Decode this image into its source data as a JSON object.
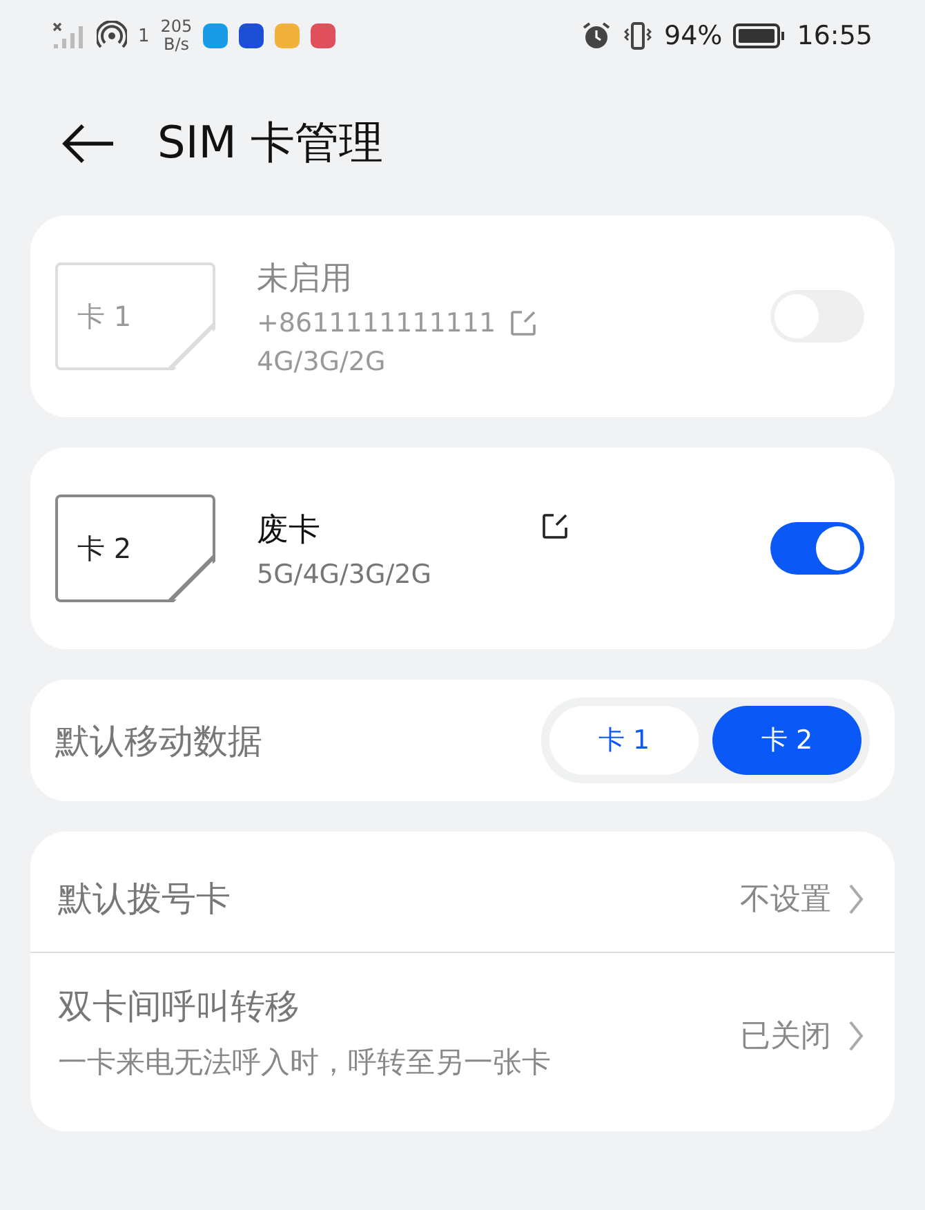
{
  "status_bar": {
    "hotspot_count": "1",
    "speed_value": "205",
    "speed_unit": "B/s",
    "apps": [
      {
        "color": "#1a9be6"
      },
      {
        "color": "#1d4fd6"
      },
      {
        "color": "#f2b13a"
      },
      {
        "color": "#e0505c"
      }
    ],
    "battery": "94%",
    "time": "16:55"
  },
  "header": {
    "title": "SIM 卡管理"
  },
  "sims": [
    {
      "slot": "卡 1",
      "name": "未启用",
      "number": "+8611111111111",
      "network": "4G/3G/2G",
      "on": false,
      "disabled": true
    },
    {
      "slot": "卡 2",
      "name": "废卡",
      "network": "5G/4G/3G/2G",
      "on": true,
      "disabled": false
    }
  ],
  "default_data": {
    "label": "默认移动数据",
    "options": [
      {
        "label": "卡 1",
        "selected": false
      },
      {
        "label": "卡 2",
        "selected": true
      }
    ]
  },
  "settings": [
    {
      "title": "默认拨号卡",
      "value": "不设置"
    },
    {
      "title": "双卡间呼叫转移",
      "subtitle": "一卡来电无法呼入时，呼转至另一张卡",
      "value": "已关闭"
    }
  ]
}
